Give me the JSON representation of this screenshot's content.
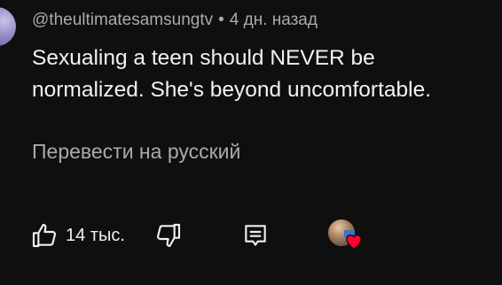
{
  "comment": {
    "author": "@theultimatesamsungtv",
    "separator": "•",
    "timestamp": "4 дн. назад",
    "text_line_1": "Sexualing a teen should NEVER be",
    "text_line_2": "normalized. She's beyond uncomfortable.",
    "translate_label": "Перевести на русский"
  },
  "actions": {
    "like_count": "14 тыс.",
    "like_icon": "thumbs-up-icon",
    "dislike_icon": "thumbs-down-icon",
    "reply_icon": "reply-comment-icon",
    "creator_heart_icon": "creator-heart-icon"
  },
  "colors": {
    "background": "#0f0f0f",
    "primary_text": "#f1f1f1",
    "secondary_text": "#aaaaaa",
    "heart": "#ff0033"
  }
}
